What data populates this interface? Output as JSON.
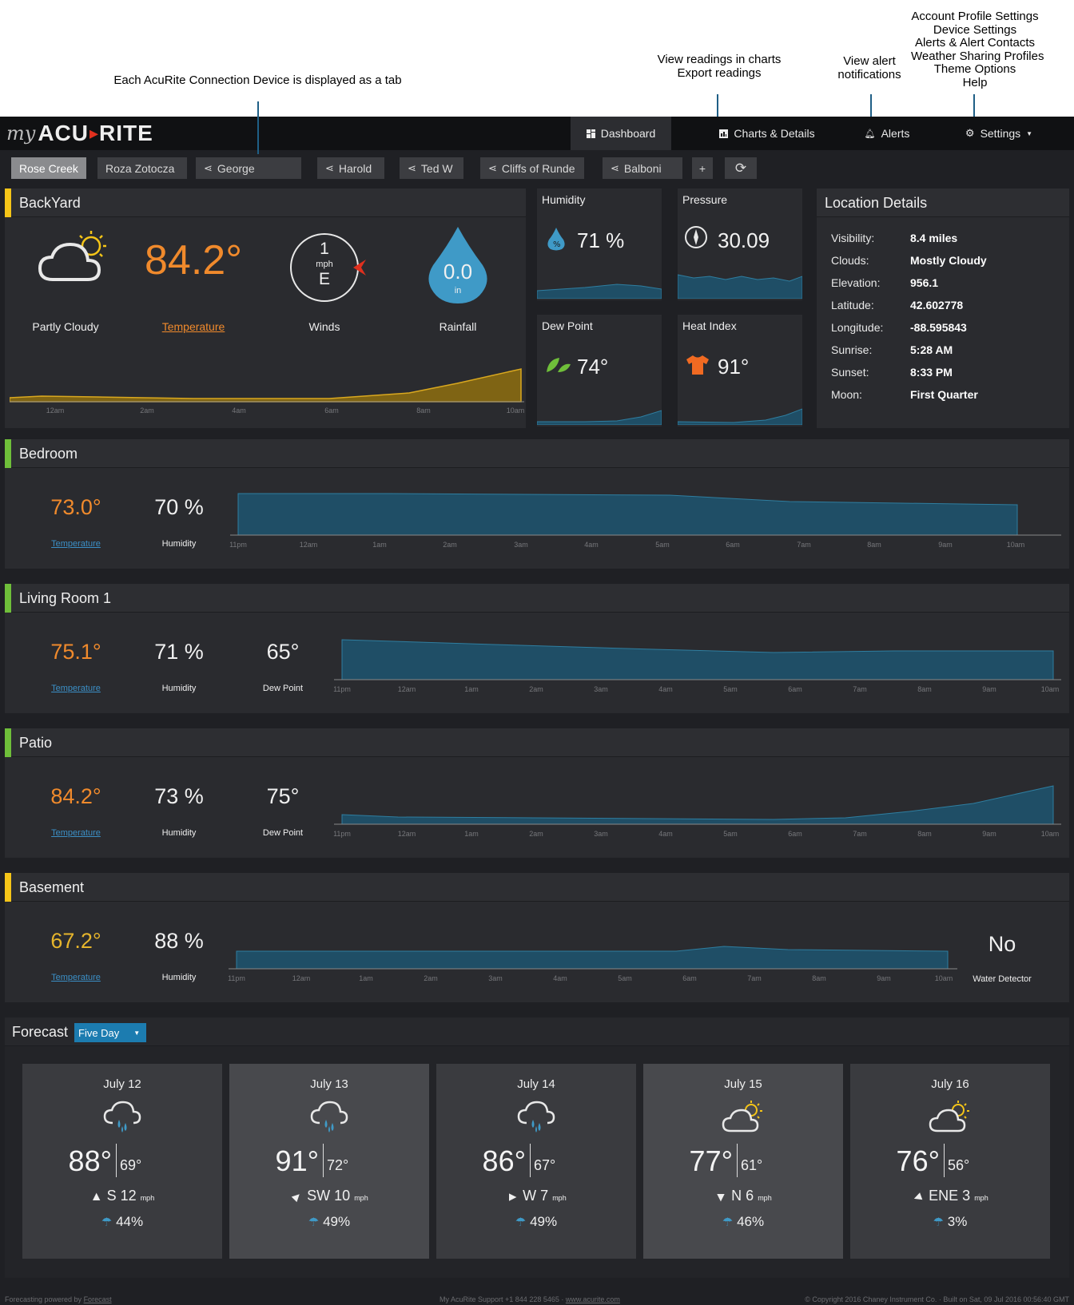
{
  "annotations": {
    "settings_menu": [
      "Account Profile Settings",
      "Device Settings",
      "Alerts & Alert Contacts",
      "Weather Sharing Profiles",
      "Theme Options",
      "Help"
    ],
    "charts_note": [
      "View readings in charts",
      "Export readings"
    ],
    "alerts_note": [
      "View alert",
      "notifications"
    ],
    "tabs_note": "Each AcuRite Connection Device is displayed as a tab"
  },
  "nav": {
    "logo_my": "my",
    "logo_brand_a": "ACU",
    "logo_brand_b": "RITE",
    "dashboard": "Dashboard",
    "charts": "Charts & Details",
    "alerts": "Alerts",
    "settings": "Settings"
  },
  "device_tabs": [
    "Rose Creek",
    "Roza Zotocza",
    "George",
    "Harold",
    "Ted W",
    "Cliffs of Runde",
    "Balboni"
  ],
  "tab_add": "+",
  "backyard": {
    "title": "BackYard",
    "accent": "#f5c518",
    "condition": "Partly Cloudy",
    "temp": "84.2°",
    "temp_label": "Temperature",
    "wind_speed": "1",
    "wind_unit": "mph",
    "wind_dir": "E",
    "wind_label": "Winds",
    "rain": "0.0",
    "rain_unit": "in",
    "rain_label": "Rainfall",
    "ticks": [
      "12am",
      "2am",
      "4am",
      "6am",
      "8am",
      "10am"
    ]
  },
  "humidity": {
    "title": "Humidity",
    "value": "71 %"
  },
  "pressure": {
    "title": "Pressure",
    "value": "30.09"
  },
  "dewpoint": {
    "title": "Dew Point",
    "value": "74°"
  },
  "heatindex": {
    "title": "Heat Index",
    "value": "91°"
  },
  "location": {
    "title": "Location Details",
    "rows": [
      {
        "k": "Visibility:",
        "v": "8.4 miles"
      },
      {
        "k": "Clouds:",
        "v": "Mostly Cloudy"
      },
      {
        "k": "Elevation:",
        "v": "956.1"
      },
      {
        "k": "Latitude:",
        "v": "42.602778"
      },
      {
        "k": "Longitude:",
        "v": "-88.595843"
      },
      {
        "k": "Sunrise:",
        "v": "5:28 AM"
      },
      {
        "k": "Sunset:",
        "v": "8:33 PM"
      },
      {
        "k": "Moon:",
        "v": "First Quarter"
      }
    ]
  },
  "sensors": [
    {
      "title": "Bedroom",
      "accent": "#6fbf3a",
      "temp": "73.0°",
      "temp_color": "#f08a2c",
      "temp_label": "Temperature",
      "humidity": "70 %",
      "humidity_label": "Humidity",
      "ticks": [
        "11pm",
        "12am",
        "1am",
        "2am",
        "3am",
        "4am",
        "5am",
        "6am",
        "7am",
        "8am",
        "9am",
        "10am"
      ]
    },
    {
      "title": "Living Room 1",
      "accent": "#6fbf3a",
      "temp": "75.1°",
      "temp_color": "#f08a2c",
      "temp_label": "Temperature",
      "humidity": "71 %",
      "humidity_label": "Humidity",
      "dew": "65°",
      "dew_label": "Dew Point",
      "ticks": [
        "11pm",
        "12am",
        "1am",
        "2am",
        "3am",
        "4am",
        "5am",
        "6am",
        "7am",
        "8am",
        "9am",
        "10am"
      ]
    },
    {
      "title": "Patio",
      "accent": "#6fbf3a",
      "temp": "84.2°",
      "temp_color": "#f08a2c",
      "temp_label": "Temperature",
      "humidity": "73 %",
      "humidity_label": "Humidity",
      "dew": "75°",
      "dew_label": "Dew Point",
      "ticks": [
        "11pm",
        "12am",
        "1am",
        "2am",
        "3am",
        "4am",
        "5am",
        "6am",
        "7am",
        "8am",
        "9am",
        "10am"
      ]
    },
    {
      "title": "Basement",
      "accent": "#f5c518",
      "temp": "67.2°",
      "temp_color": "#e6b52c",
      "temp_label": "Temperature",
      "humidity": "88 %",
      "humidity_label": "Humidity",
      "water": "No",
      "water_label": "Water Detector",
      "ticks": [
        "11pm",
        "12am",
        "1am",
        "2am",
        "3am",
        "4am",
        "5am",
        "6am",
        "7am",
        "8am",
        "9am",
        "10am"
      ]
    }
  ],
  "forecast": {
    "title": "Forecast",
    "select": "Five Day",
    "days": [
      {
        "date": "July 12",
        "icon": "rain-cloud-icon",
        "high": "88°",
        "low": "69°",
        "wind": "S 12",
        "unit": "mph",
        "pop": "44%"
      },
      {
        "date": "July 13",
        "icon": "rain-cloud-icon",
        "high": "91°",
        "low": "72°",
        "wind": "SW 10",
        "unit": "mph",
        "pop": "49%"
      },
      {
        "date": "July 14",
        "icon": "rain-cloud-icon",
        "high": "86°",
        "low": "67°",
        "wind": "W 7",
        "unit": "mph",
        "pop": "49%"
      },
      {
        "date": "July 15",
        "icon": "partly-cloudy-icon",
        "high": "77°",
        "low": "61°",
        "wind": "N 6",
        "unit": "mph",
        "pop": "46%"
      },
      {
        "date": "July 16",
        "icon": "partly-cloudy-icon",
        "high": "76°",
        "low": "56°",
        "wind": "ENE 3",
        "unit": "mph",
        "pop": "3%"
      }
    ]
  },
  "footer": {
    "left_prefix": "Forecasting powered by ",
    "left_link": "Forecast",
    "center_prefix": "My AcuRite Support +1 844 228 5465 · ",
    "center_link": "www.acurite.com",
    "right": "© Copyright 2016 Chaney Instrument Co. · Built on Sat, 09 Jul 2016 00:56:40 GMT"
  },
  "colors": {
    "accent_yellow": "#f5c518",
    "accent_green": "#6fbf3a",
    "temp_orange": "#f08a2c",
    "chart_teal": "#1f4e66",
    "link_blue": "#3b8fc6"
  }
}
